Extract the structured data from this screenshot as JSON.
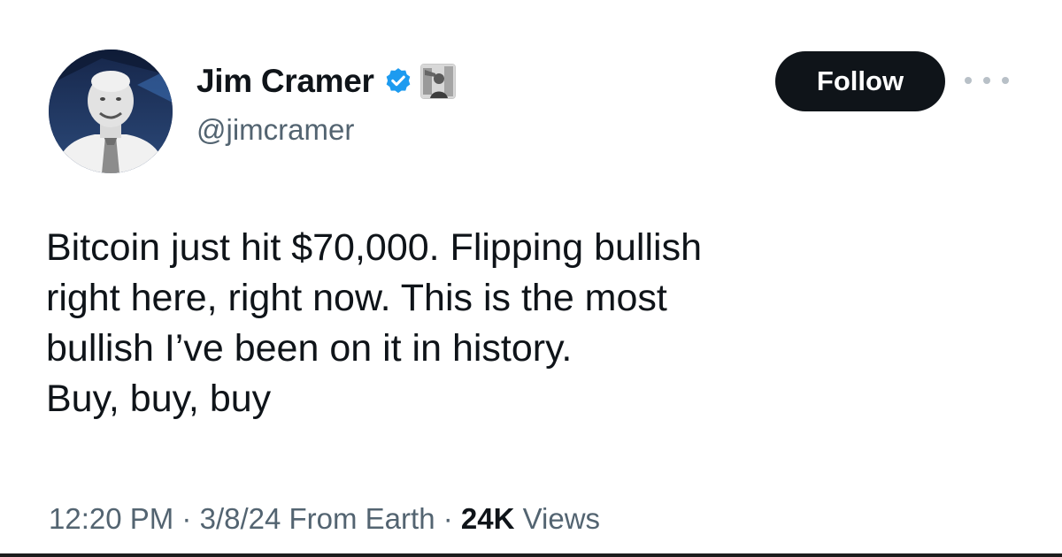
{
  "author": {
    "display_name": "Jim Cramer",
    "handle": "@jimcramer",
    "verified": true
  },
  "follow_button": {
    "label": "Follow"
  },
  "tweet": {
    "lines": [
      "Bitcoin just hit $70,000. Flipping bullish",
      "right here, right now. This is the most",
      "bullish I’ve been on it in history.",
      "Buy, buy, buy"
    ]
  },
  "meta": {
    "time": "12:20 PM",
    "separator": "·",
    "date_source": "3/8/24 From Earth",
    "views_count": "24K",
    "views_label": "Views"
  },
  "icons": {
    "verified": "verified-badge-icon",
    "affiliate": "affiliate-badge-icon",
    "more": "more-options-icon"
  },
  "colors": {
    "verified_blue": "#1d9bf0",
    "button_bg": "#0f1419",
    "secondary_text": "#536471"
  }
}
